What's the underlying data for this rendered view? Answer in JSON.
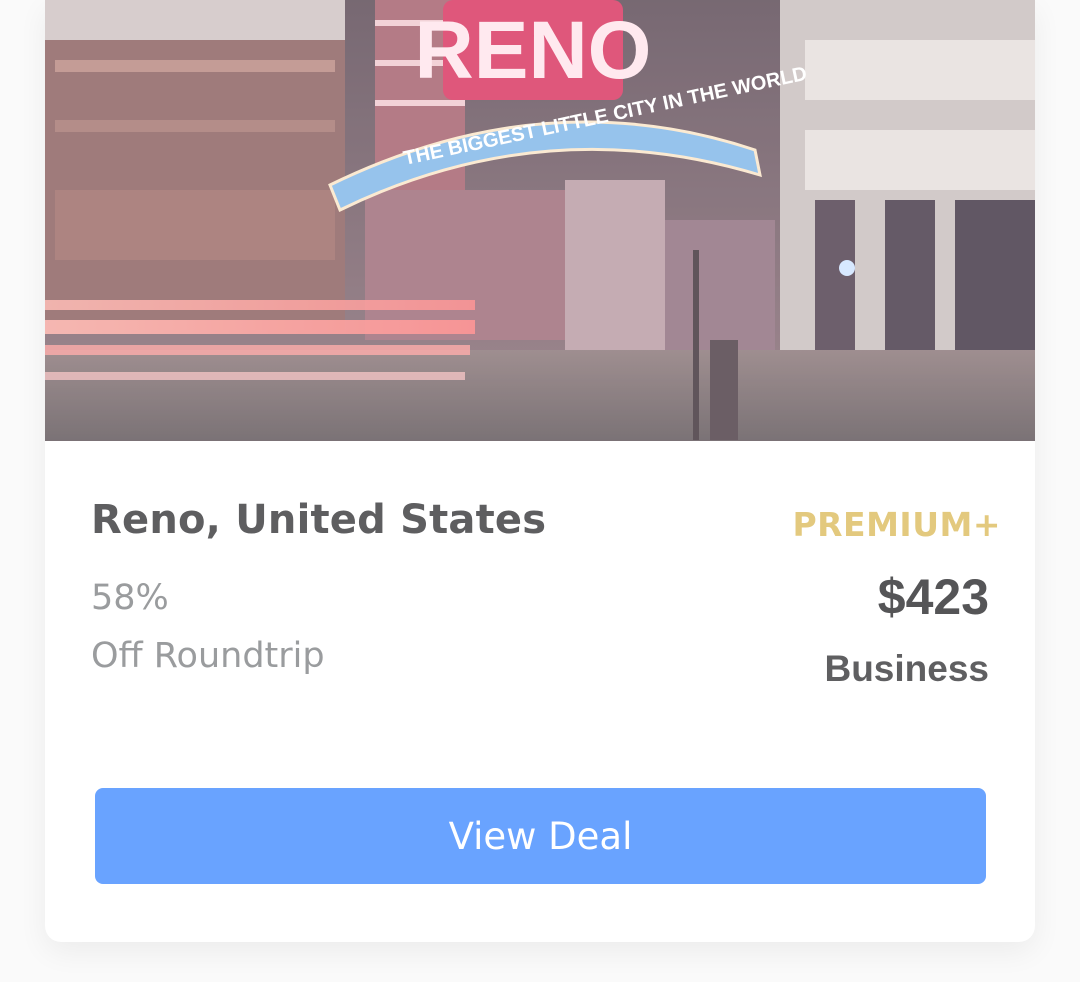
{
  "deal": {
    "destination": "Reno, United States",
    "discount_percent": "58%",
    "discount_label": "Off Roundtrip",
    "tier": "PREMIUM+",
    "price": "$423",
    "cabin_class": "Business",
    "cta_label": "View Deal"
  },
  "hero_image": {
    "sign_word": "RENO",
    "arch_text": "THE BIGGEST LITTLE CITY IN THE WORLD"
  },
  "colors": {
    "tier": "#e3c97e",
    "button": "#69a3ff",
    "title": "#5e5e60",
    "muted": "#9a9c9e"
  }
}
